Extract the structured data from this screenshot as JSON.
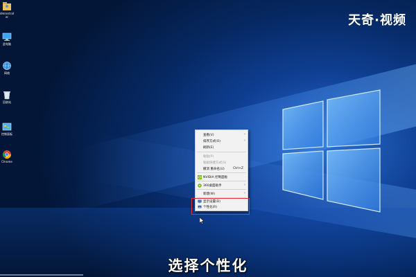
{
  "watermark": "天奇·视频",
  "desktop_icons": [
    {
      "label": "dministrat\nor",
      "icon": "user-folder-icon"
    },
    {
      "label": "此电脑",
      "icon": "computer-icon"
    },
    {
      "label": "网络",
      "icon": "network-icon"
    },
    {
      "label": "回收站",
      "icon": "recycle-bin-icon"
    },
    {
      "label": "控制面板",
      "icon": "control-panel-icon"
    },
    {
      "label": "Chrome",
      "icon": "chrome-icon"
    }
  ],
  "context_menu": {
    "items": [
      {
        "label": "查看(V)",
        "submenu": true,
        "disabled": false
      },
      {
        "label": "排序方式(O)",
        "submenu": true,
        "disabled": false
      },
      {
        "label": "刷新(E)",
        "submenu": false,
        "disabled": false
      },
      {
        "label": "粘贴(P)",
        "submenu": false,
        "disabled": true
      },
      {
        "label": "粘贴快捷方式(S)",
        "submenu": false,
        "disabled": true
      },
      {
        "label": "撤消 重命名(U)",
        "shortcut": "Ctrl+Z",
        "submenu": false,
        "disabled": false
      },
      {
        "label": "NVIDIA 控制面板",
        "submenu": false,
        "disabled": false,
        "icon": "nvidia-icon"
      },
      {
        "label": "360桌面助手",
        "submenu": true,
        "disabled": false,
        "icon": "360-icon"
      },
      {
        "label": "新建(W)",
        "submenu": true,
        "disabled": false
      },
      {
        "label": "显示设置(D)",
        "submenu": false,
        "disabled": false,
        "icon": "display-settings-icon"
      },
      {
        "label": "个性化(R)",
        "submenu": false,
        "disabled": false,
        "icon": "personalize-icon"
      }
    ]
  },
  "subtitle": "选择个性化",
  "colors": {
    "highlight_border": "#e0303a",
    "menu_bg": "#f2f2f2",
    "desktop_blue": "#0f3f93"
  }
}
